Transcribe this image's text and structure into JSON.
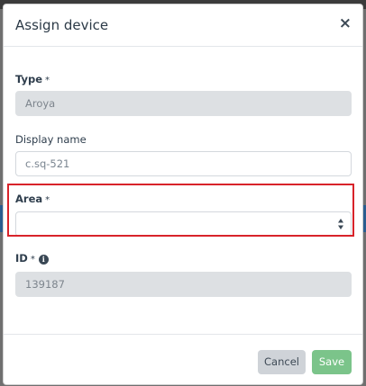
{
  "modal": {
    "title": "Assign device",
    "close_label": "×"
  },
  "fields": {
    "type": {
      "label": "Type",
      "required": "*",
      "value": "Aroya"
    },
    "display_name": {
      "label": "Display name",
      "value": "c.sq-521"
    },
    "area": {
      "label": "Area",
      "required": "*",
      "value": ""
    },
    "id": {
      "label": "ID",
      "required": "*",
      "value": "139187",
      "info_icon": "i"
    }
  },
  "footer": {
    "cancel_label": "Cancel",
    "save_label": "Save"
  },
  "colors": {
    "highlight": "#d8232a",
    "save_button": "#7bc48a",
    "cancel_button": "#cfd3d8"
  }
}
